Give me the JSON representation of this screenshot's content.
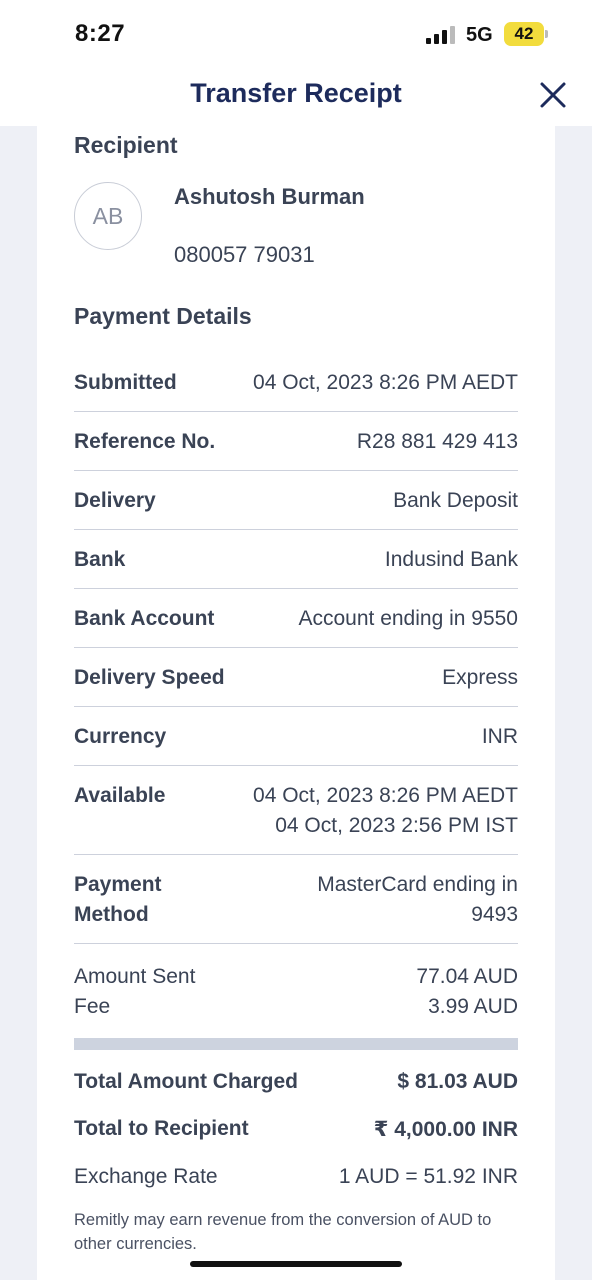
{
  "status_bar": {
    "time": "8:27",
    "network": "5G",
    "battery": "42",
    "battery_color": "#f2dc3d"
  },
  "header": {
    "title": "Transfer Receipt",
    "close_icon": "close-icon"
  },
  "recipient": {
    "section_title": "Recipient",
    "initials": "AB",
    "name": "Ashutosh Burman",
    "phone": "080057 79031"
  },
  "payment_details": {
    "section_title": "Payment Details",
    "rows": [
      {
        "label": "Submitted",
        "value": "04 Oct, 2023 8:26 PM AEDT"
      },
      {
        "label": "Reference No.",
        "value": "R28 881 429 413"
      },
      {
        "label": "Delivery",
        "value": "Bank Deposit"
      },
      {
        "label": "Bank",
        "value": "Indusind Bank"
      },
      {
        "label": "Bank Account",
        "value": "Account ending in 9550"
      },
      {
        "label": "Delivery Speed",
        "value": "Express"
      },
      {
        "label": "Currency",
        "value": "INR"
      }
    ],
    "available": {
      "label": "Available",
      "value_line1": "04 Oct, 2023 8:26 PM AEDT",
      "value_line2": "04 Oct, 2023 2:56 PM IST"
    },
    "payment_method": {
      "label_line1": "Payment",
      "label_line2": "Method",
      "value_line1": "MasterCard ending in",
      "value_line2": "9493"
    }
  },
  "amounts": {
    "sent_label": "Amount Sent",
    "sent_value": "77.04 AUD",
    "fee_label": "Fee",
    "fee_value": "3.99 AUD"
  },
  "totals": {
    "charged_label": "Total Amount Charged",
    "charged_value": "$ 81.03 AUD",
    "recipient_label": "Total to Recipient",
    "recipient_value": "₹ 4,000.00 INR",
    "rate_label": "Exchange Rate",
    "rate_value": "1 AUD = 51.92 INR"
  },
  "disclaimer": "Remitly may earn revenue from the conversion of AUD to other currencies.",
  "colors": {
    "title_navy": "#1d2b5c",
    "text": "#3a4355",
    "background": "#eef0f6",
    "divider": "#cdd1dc"
  }
}
